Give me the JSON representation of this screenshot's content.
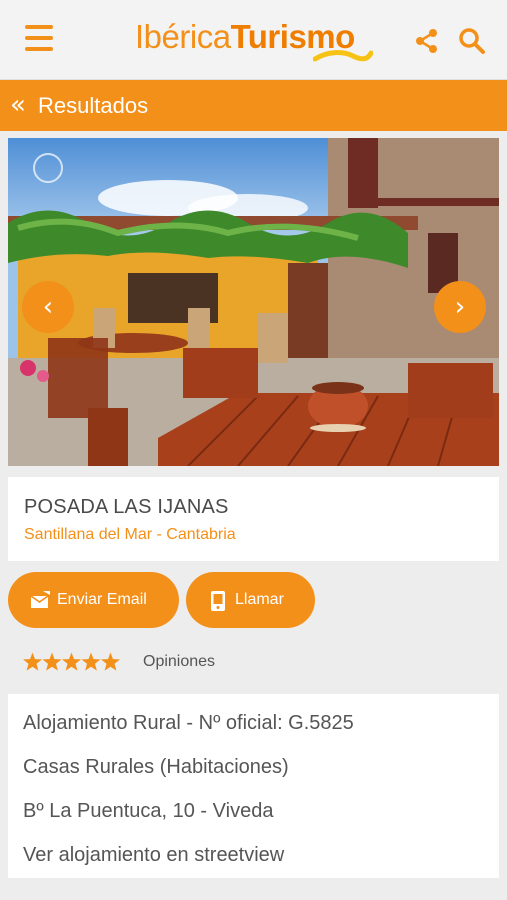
{
  "header": {
    "logo_part1": "Ibérica",
    "logo_part2": "Turismo",
    "brand_color": "#f39019",
    "icons": [
      "hamburger-menu-icon",
      "share-icon",
      "search-icon"
    ]
  },
  "results_bar": {
    "back_glyph": "«",
    "label": "Resultados"
  },
  "gallery": {
    "prev_glyph": "‹",
    "next_glyph": "›"
  },
  "listing": {
    "name": "POSADA LAS IJANAS",
    "location": "Santillana del Mar - Cantabria"
  },
  "actions": {
    "email_label": "Enviar Email",
    "call_label": "Llamar"
  },
  "rating": {
    "stars": 5,
    "max_stars": 5,
    "opinions_label": "Opiniones"
  },
  "details": {
    "line1": "Alojamiento Rural - Nº oficial: G.5825",
    "line2": "Casas Rurales (Habitaciones)",
    "line3": "Bº La Puentuca, 10 - Viveda",
    "line4": "Ver alojamiento en streetview"
  }
}
